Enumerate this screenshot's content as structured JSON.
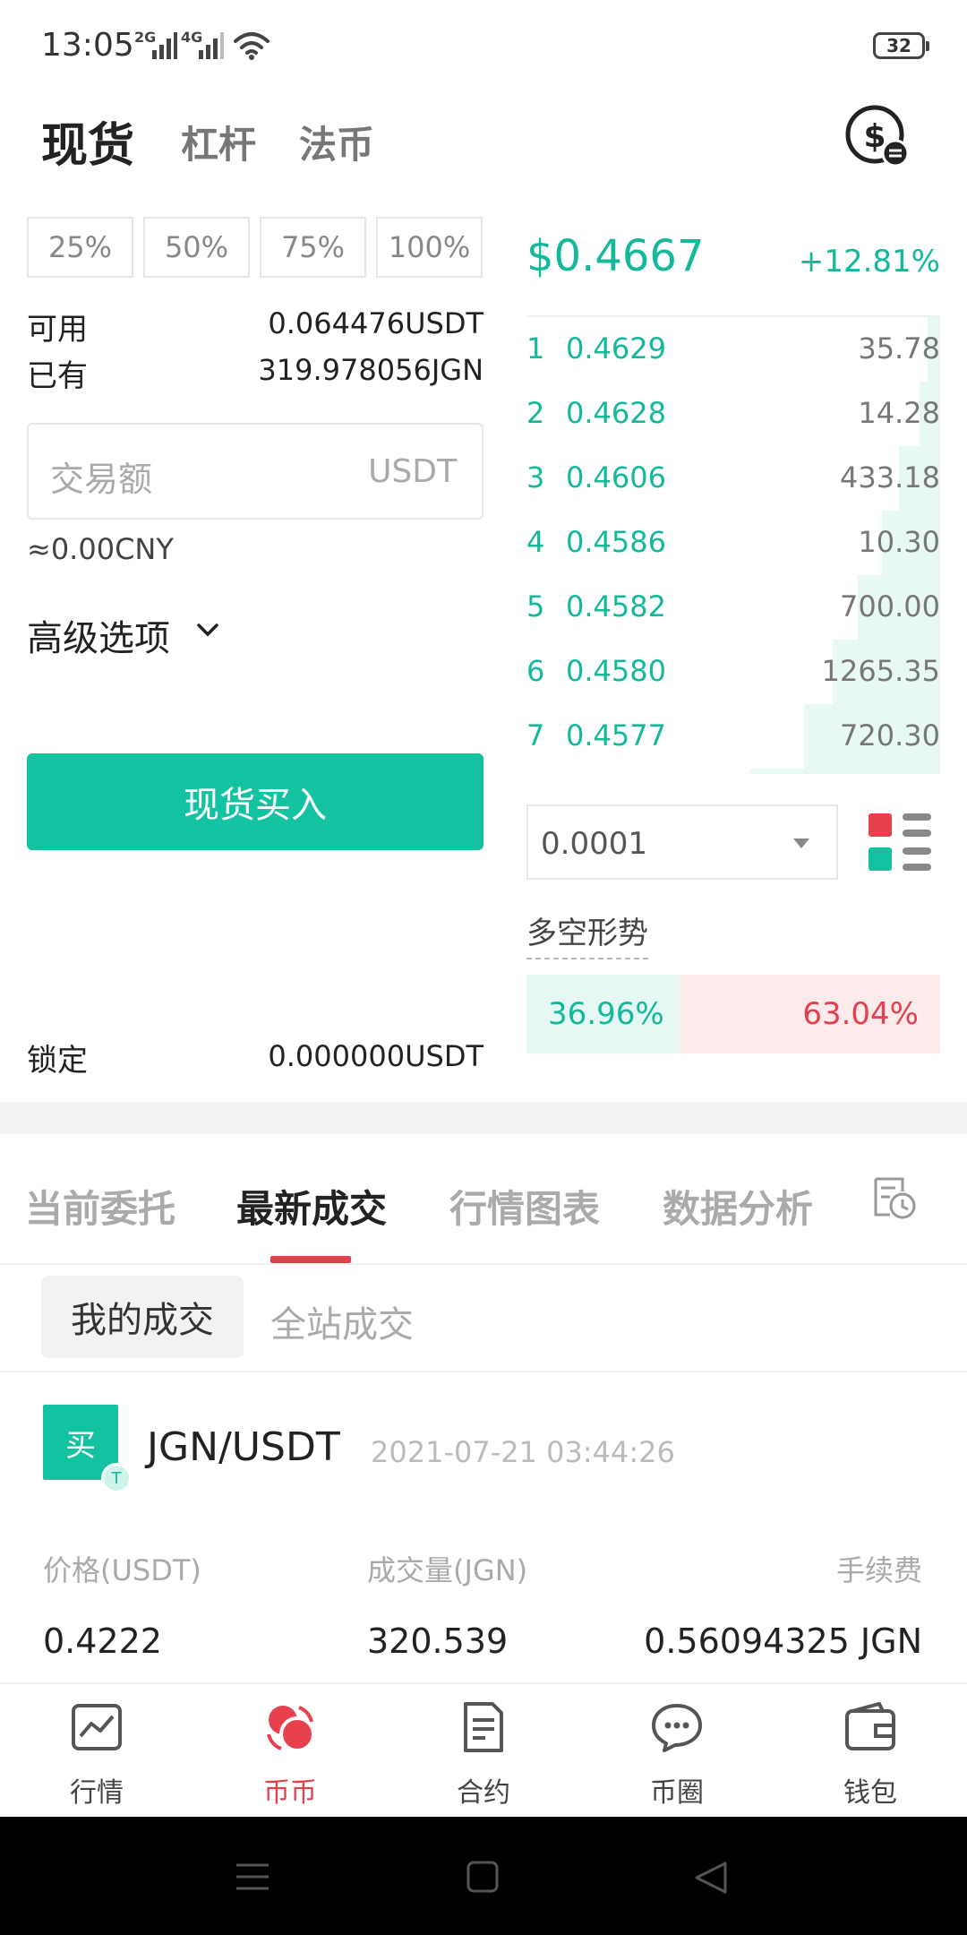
{
  "status_bar": {
    "time": "13:05",
    "signal_1": "2G",
    "signal_2": "4G",
    "battery": "32"
  },
  "header": {
    "tabs": [
      "现货",
      "杠杆",
      "法币"
    ],
    "icon": "dollar-exchange-icon"
  },
  "order_form": {
    "percent_buttons": [
      "25%",
      "50%",
      "75%",
      "100%"
    ],
    "available_label": "可用",
    "available_value": "0.064476USDT",
    "held_label": "已有",
    "held_value": "319.978056JGN",
    "amount_placeholder": "交易额",
    "amount_unit": "USDT",
    "cny_estimate": "≈0.00CNY",
    "advanced_label": "高级选项",
    "buy_button": "现货买入",
    "locked_label": "锁定",
    "locked_value": "0.000000USDT"
  },
  "market": {
    "last_price": "$0.4667",
    "change": "+12.81%",
    "orderbook": [
      {
        "index": "1",
        "price": "0.4629",
        "qty": "35.78",
        "depth": 0.03
      },
      {
        "index": "2",
        "price": "0.4628",
        "qty": "14.28",
        "depth": 0.05
      },
      {
        "index": "3",
        "price": "0.4606",
        "qty": "433.18",
        "depth": 0.1
      },
      {
        "index": "4",
        "price": "0.4586",
        "qty": "10.30",
        "depth": 0.14
      },
      {
        "index": "5",
        "price": "0.4582",
        "qty": "700.00",
        "depth": 0.2
      },
      {
        "index": "6",
        "price": "0.4580",
        "qty": "1265.35",
        "depth": 0.26
      },
      {
        "index": "7",
        "price": "0.4577",
        "qty": "720.30",
        "depth": 0.33
      }
    ],
    "precision_value": "0.0001",
    "long_short_title": "多空形势",
    "long_pct": "36.96%",
    "short_pct": "63.04%",
    "long_fraction": 0.3696
  },
  "records": {
    "tabs": [
      "当前委托",
      "最新成交",
      "行情图表",
      "数据分析"
    ],
    "active_tab": 1,
    "segments": [
      "我的成交",
      "全站成交"
    ],
    "trade": {
      "side": "买",
      "tag": "T",
      "pair": "JGN/USDT",
      "time": "2021-07-21 03:44:26",
      "price_label": "价格(USDT)",
      "volume_label": "成交量(JGN)",
      "fee_label": "手续费",
      "price": "0.4222",
      "volume": "320.539",
      "fee": "0.56094325 JGN"
    }
  },
  "bottom_nav": [
    "行情",
    "币币",
    "合约",
    "币圈",
    "钱包"
  ],
  "colors": {
    "accent_green": "#12c2a0",
    "accent_red": "#e2404c",
    "short_bg": "#fdeaea",
    "long_bg": "#e6f8f3"
  }
}
